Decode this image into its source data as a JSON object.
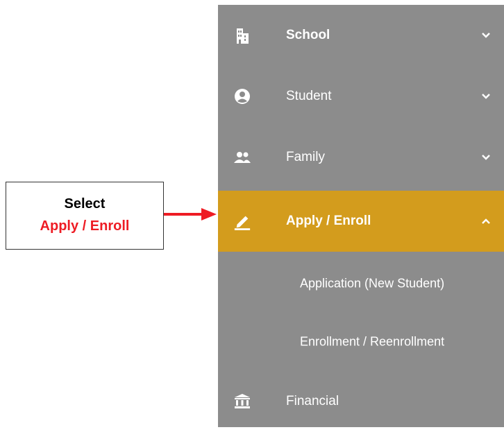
{
  "sidebar": {
    "items": [
      {
        "label": "School",
        "icon": "building-icon",
        "expanded": false
      },
      {
        "label": "Student",
        "icon": "person-circle-icon",
        "expanded": false
      },
      {
        "label": "Family",
        "icon": "people-icon",
        "expanded": false
      },
      {
        "label": "Apply / Enroll",
        "icon": "pencil-icon",
        "expanded": true,
        "active": true
      },
      {
        "label": "Financial",
        "icon": "bank-icon"
      }
    ],
    "subitems": [
      {
        "label": "Application (New Student)"
      },
      {
        "label": "Enrollment / Reenrollment"
      }
    ]
  },
  "callout": {
    "line1": "Select",
    "line2": "Apply / Enroll"
  },
  "colors": {
    "sidebar_bg": "#8c8c8c",
    "active_bg": "#d39c1d",
    "callout_highlight": "#ee1c24",
    "arrow": "#ee1c24"
  }
}
